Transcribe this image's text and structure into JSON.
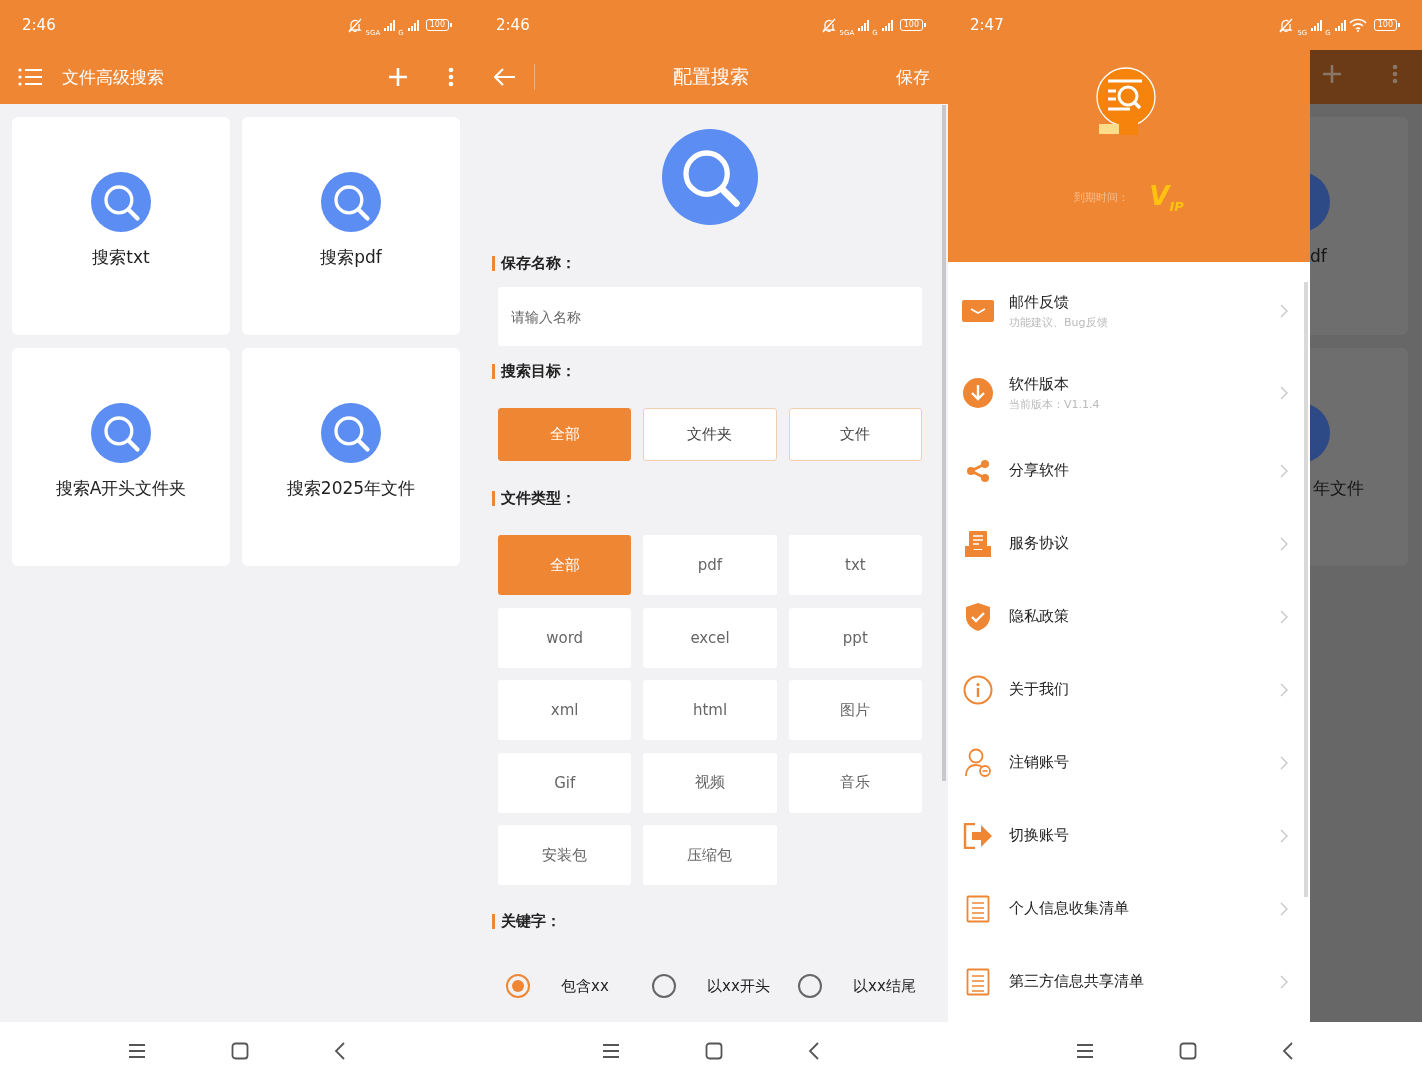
{
  "home_screen": {
    "status_bar": {
      "time": "2:46",
      "network_1": "5GA",
      "network_2": "G",
      "wifi": false,
      "battery": "100"
    },
    "toolbar": {
      "title": "文件高级搜索"
    },
    "cards": [
      {
        "label": "搜索txt"
      },
      {
        "label": "搜索pdf"
      },
      {
        "label": "搜索A开头文件夹"
      },
      {
        "label": "搜索2025年文件"
      }
    ]
  },
  "config_screen": {
    "status_bar": {
      "time": "2:46",
      "network_1": "5GA",
      "network_2": "G",
      "wifi": false,
      "battery": "100"
    },
    "toolbar": {
      "title": "配置搜索",
      "action": "保存"
    },
    "name_label": "保存名称：",
    "name_field": {
      "placeholder": "请输入名称"
    },
    "target_label": "搜索目标：",
    "targets": [
      {
        "label": "全部",
        "selected": true
      },
      {
        "label": "文件夹",
        "selected": false
      },
      {
        "label": "文件",
        "selected": false
      }
    ],
    "type_label": "文件类型：",
    "types": [
      {
        "label": "全部",
        "selected": true
      },
      {
        "label": "pdf",
        "selected": false
      },
      {
        "label": "txt",
        "selected": false
      },
      {
        "label": "word",
        "selected": false
      },
      {
        "label": "excel",
        "selected": false
      },
      {
        "label": "ppt",
        "selected": false
      },
      {
        "label": "xml",
        "selected": false
      },
      {
        "label": "html",
        "selected": false
      },
      {
        "label": "图片",
        "selected": false
      },
      {
        "label": "Gif",
        "selected": false
      },
      {
        "label": "视频",
        "selected": false
      },
      {
        "label": "音乐",
        "selected": false
      },
      {
        "label": "安装包",
        "selected": false
      },
      {
        "label": "压缩包",
        "selected": false
      }
    ],
    "keyword_label": "关键字：",
    "keyword_options": [
      {
        "label": "包含xx",
        "selected": true
      },
      {
        "label": "以xx开头",
        "selected": false
      },
      {
        "label": "以xx结尾",
        "selected": false
      }
    ]
  },
  "drawer_screen": {
    "status_bar": {
      "time": "2:47",
      "network_1": "5G",
      "network_2": "G",
      "wifi": true,
      "battery": "100"
    },
    "drawer": {
      "expiry_label": "到期时间：",
      "vip_badge": "V$_{IP}$",
      "items": [
        {
          "title": "邮件反馈",
          "subtitle": "功能建议、Bug反馈"
        },
        {
          "title": "软件版本",
          "subtitle": "当前版本：V1.1.4"
        },
        {
          "title": "分享软件"
        },
        {
          "title": "服务协议"
        },
        {
          "title": "隐私政策"
        },
        {
          "title": "关于我们"
        },
        {
          "title": "注销账号"
        },
        {
          "title": "切换账号"
        },
        {
          "title": "个人信息收集清单"
        },
        {
          "title": "第三方信息共享清单"
        }
      ]
    },
    "dimmed_background": {
      "cards": [
        {
          "label": "df"
        },
        {
          "label": "年文件"
        }
      ]
    }
  }
}
